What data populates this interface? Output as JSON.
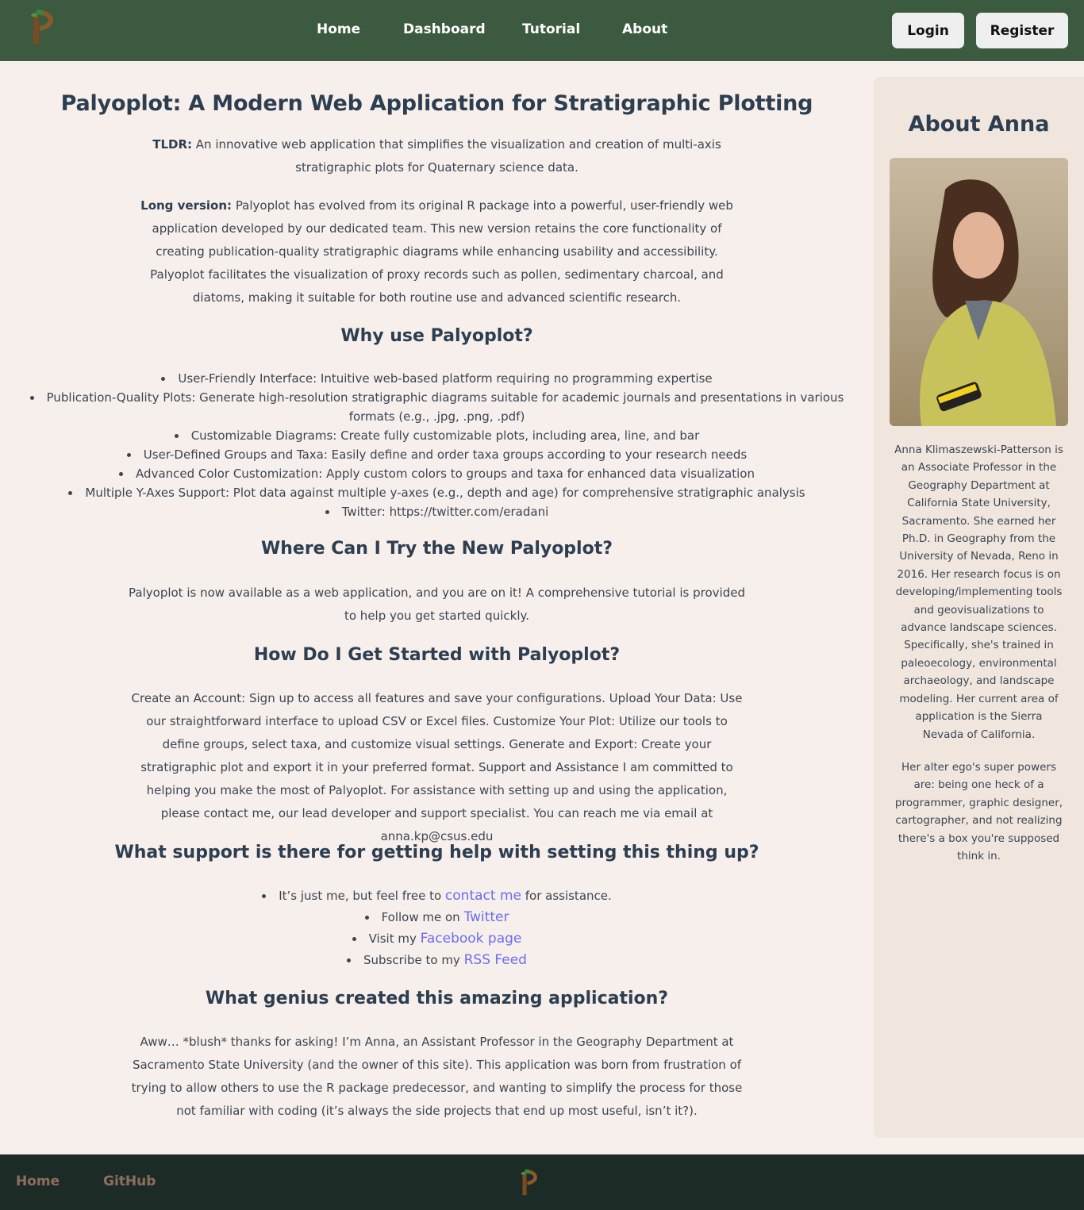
{
  "nav": {
    "links": [
      "Home",
      "Dashboard",
      "Tutorial",
      "About"
    ],
    "login": "Login",
    "register": "Register"
  },
  "main": {
    "title": "Palyoplot: A Modern Web Application for Stratigraphic Plotting",
    "tldr_label": "TLDR:",
    "tldr_text": " An innovative web application that simplifies the visualization and creation of multi-axis stratigraphic plots for Quaternary science data.",
    "long_label": "Long version:",
    "long_text": " Palyoplot has evolved from its original R package into a powerful, user-friendly web application developed by our dedicated team. This new version retains the core functionality of creating publication-quality stratigraphic diagrams while enhancing usability and accessibility. Palyoplot facilitates the visualization of proxy records such as pollen, sedimentary charcoal, and diatoms, making it suitable for both routine use and advanced scientific research.",
    "why_heading": "Why use Palyoplot?",
    "why_items": [
      "User-Friendly Interface: Intuitive web-based platform requiring no programming expertise",
      "Publication-Quality Plots: Generate high-resolution stratigraphic diagrams suitable for academic journals and presentations in various formats (e.g., .jpg, .png, .pdf)",
      "Customizable Diagrams: Create fully customizable plots, including area, line, and bar",
      "User-Defined Groups and Taxa: Easily define and order taxa groups according to your research needs",
      "Advanced Color Customization: Apply custom colors to groups and taxa for enhanced data visualization",
      "Multiple Y-Axes Support: Plot data against multiple y-axes (e.g., depth and age) for comprehensive stratigraphic analysis",
      "Twitter: https://twitter.com/eradani"
    ],
    "where_heading": "Where Can I Try the New Palyoplot?",
    "where_text": "Palyoplot is now available as a web application, and you are on it! A comprehensive tutorial is provided to help you get started quickly.",
    "how_heading": "How Do I Get Started with Palyoplot?",
    "how_text": "Create an Account: Sign up to access all features and save your configurations. Upload Your Data: Use our straightforward interface to upload CSV or Excel files. Customize Your Plot: Utilize our tools to define groups, select taxa, and customize visual settings. Generate and Export: Create your stratigraphic plot and export it in your preferred format. Support and Assistance I am committed to helping you make the most of Palyoplot. For assistance with setting up and using the application, please contact me, our lead developer and support specialist. You can reach me via email at anna.kp@csus.edu",
    "support_heading": "What support is there for getting help with setting this thing up?",
    "support_items": [
      {
        "pre": "It’s just me, but feel free to ",
        "link": "contact me",
        "post": " for assistance."
      },
      {
        "pre": "Follow me on ",
        "link": "Twitter",
        "post": ""
      },
      {
        "pre": "Visit my ",
        "link": "Facebook page",
        "post": ""
      },
      {
        "pre": "Subscribe to my ",
        "link": "RSS Feed",
        "post": ""
      }
    ],
    "genius_heading": "What genius created this amazing application?",
    "genius_text": "Aww… *blush* thanks for asking! I’m Anna, an Assistant Professor in the Geography Department at Sacramento State University (and the owner of this site). This application was born from frustration of trying to allow others to use the R package predecessor, and wanting to simplify the process for those not familiar with coding (it’s always the side projects that end up most useful, isn’t it?)."
  },
  "sidebar": {
    "heading": "About Anna",
    "bio1": "Anna Klimaszewski-Patterson is an Associate Professor in the Geography Department at California State University, Sacramento. She earned her Ph.D. in Geography from the University of Nevada, Reno in 2016. Her research focus is on developing/implementing tools and geovisualizations to advance landscape sciences. Specifically, she's trained in paleoecology, environmental archaeology, and landscape modeling. Her current area of application is the Sierra Nevada of California.",
    "bio2": "Her alter ego's super powers are: being one heck of a programmer, graphic designer, cartographer, and not realizing there's a box you're supposed think in."
  },
  "footer": {
    "home": "Home",
    "github": "GitHub"
  }
}
